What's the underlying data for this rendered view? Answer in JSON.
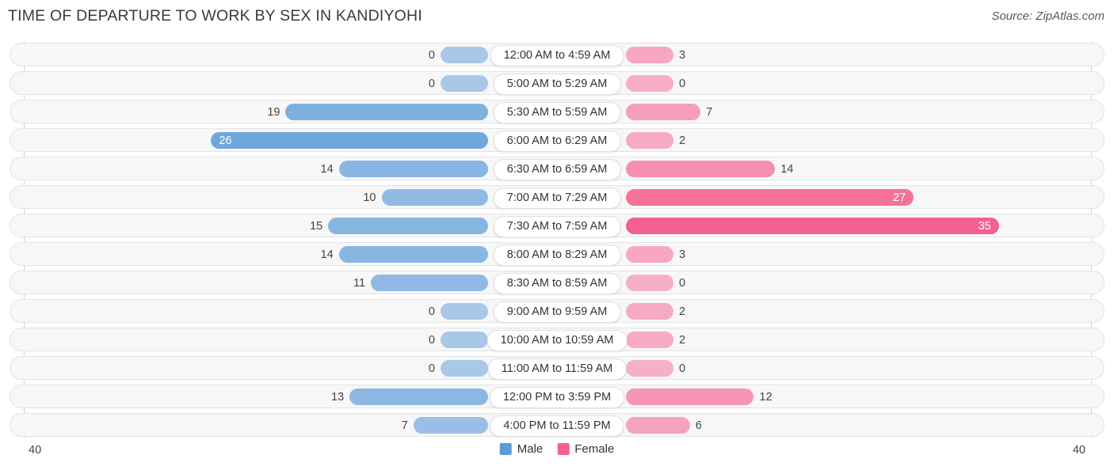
{
  "header": {
    "title": "TIME OF DEPARTURE TO WORK BY SEX IN KANDIYOHI",
    "source": "Source: ZipAtlas.com"
  },
  "axis": {
    "left_label": "40",
    "right_label": "40"
  },
  "legend": {
    "male_label": "Male",
    "female_label": "Female"
  },
  "colors": {
    "male_min": "#a8c8ea",
    "male_max": "#5b9bd5",
    "female_min": "#f7aec8",
    "female_max": "#f4618e",
    "row_bg": "#f7f7f7",
    "row_border": "#e3e3e3",
    "axis_line": "#d2d2d2",
    "title_color": "#3a3a3a"
  },
  "chart_data": {
    "type": "bar",
    "title": "TIME OF DEPARTURE TO WORK BY SEX IN KANDIYOHI",
    "subtitle": "",
    "orientation": "horizontal-diverging",
    "xlabel": "",
    "ylabel": "",
    "xlim": [
      40,
      40
    ],
    "grid": false,
    "legend_position": "bottom-center",
    "categories": [
      "12:00 AM to 4:59 AM",
      "5:00 AM to 5:29 AM",
      "5:30 AM to 5:59 AM",
      "6:00 AM to 6:29 AM",
      "6:30 AM to 6:59 AM",
      "7:00 AM to 7:29 AM",
      "7:30 AM to 7:59 AM",
      "8:00 AM to 8:29 AM",
      "8:30 AM to 8:59 AM",
      "9:00 AM to 9:59 AM",
      "10:00 AM to 10:59 AM",
      "11:00 AM to 11:59 AM",
      "12:00 PM to 3:59 PM",
      "4:00 PM to 11:59 PM"
    ],
    "series": [
      {
        "name": "Male",
        "values": [
          0,
          0,
          19,
          26,
          14,
          10,
          15,
          14,
          11,
          0,
          0,
          0,
          13,
          7
        ]
      },
      {
        "name": "Female",
        "values": [
          3,
          0,
          7,
          2,
          14,
          27,
          35,
          3,
          0,
          2,
          2,
          0,
          12,
          6
        ]
      }
    ]
  }
}
